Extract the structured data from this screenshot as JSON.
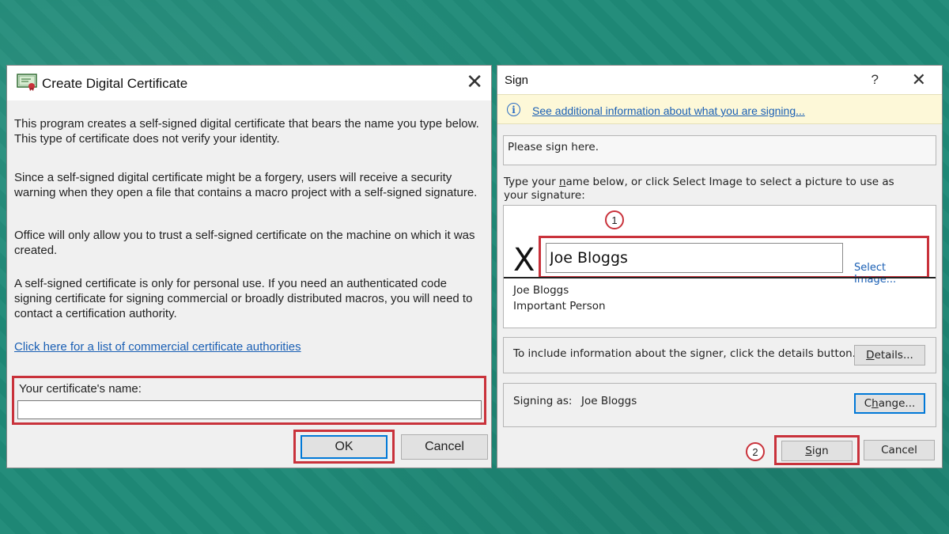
{
  "left_dialog": {
    "title": "Create Digital Certificate",
    "close": "✕",
    "paragraphs": [
      "This program creates a self-signed digital certificate that bears the name you type below. This type of certificate does not verify your identity.",
      "Since a self-signed digital certificate might be a forgery, users will receive a security warning when they open a file that contains a macro project with a self-signed signature.",
      "Office will only allow you to trust a self-signed certificate on the machine on which it was created.",
      "A self-signed certificate is only for personal use. If you need an authenticated code signing certificate for signing commercial or broadly distributed macros, you will need to contact a certification authority."
    ],
    "link": "Click here for a list of commercial certificate authorities",
    "name_label": "Your certificate's name:",
    "name_value": "",
    "ok_label": "OK",
    "cancel_label": "Cancel"
  },
  "right_dialog": {
    "title": "Sign",
    "help": "?",
    "close": "✕",
    "info_link": "See additional information about what you are signing...",
    "please_sign": "Please sign here.",
    "instructions_pre": "Type your ",
    "instructions_key": "n",
    "instructions_post": "ame below, or click Select Image to select a picture to use as your signature:",
    "marker_1": "1",
    "marker_2": "2",
    "x_mark": "X",
    "signature_value": "Joe Bloggs",
    "select_image": "Select Image...",
    "signer_name": "Joe Bloggs",
    "signer_title": "Important Person",
    "details_text": "To include information about the signer, click the details button.",
    "details_key": "D",
    "details_rest": "etails...",
    "signing_as_label": "Signing as:",
    "signing_as_name": "Joe Bloggs",
    "change_pre": "C",
    "change_key": "h",
    "change_post": "ange...",
    "sign_key": "S",
    "sign_rest": "ign",
    "cancel_label": "Cancel"
  },
  "colors": {
    "background": "#1f8a78",
    "highlight_red": "#c9323b",
    "link_blue": "#1a5fb4",
    "info_bar": "#fdf8d8"
  },
  "icons": {
    "certificate": "certificate-icon",
    "info": "info-icon",
    "close": "close-icon"
  }
}
